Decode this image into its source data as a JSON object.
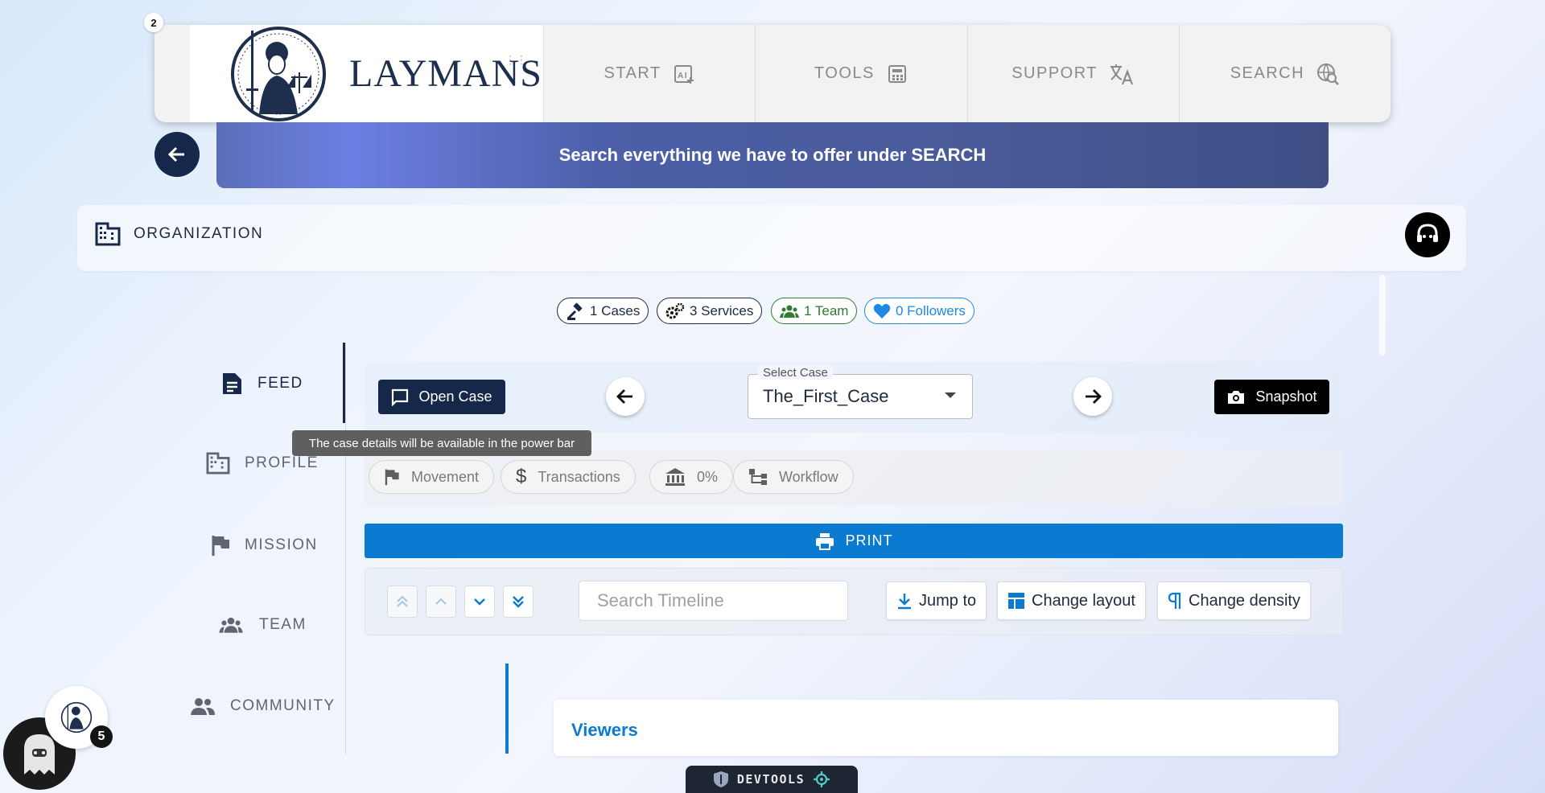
{
  "nav": {
    "badge": "2",
    "logo_text": "LAYMANS",
    "items": [
      {
        "label": "START",
        "icon": "ai-spark-icon"
      },
      {
        "label": "TOOLS",
        "icon": "calculator-icon"
      },
      {
        "label": "SUPPORT",
        "icon": "translate-icon"
      },
      {
        "label": "SEARCH",
        "icon": "search-globe-icon"
      }
    ]
  },
  "banner": {
    "text": "Search everything we have to offer under SEARCH"
  },
  "header": {
    "title": "ORGANIZATION"
  },
  "stats": {
    "cases": "1 Cases",
    "services": "3 Services",
    "team": "1 Team",
    "followers": "0 Followers"
  },
  "sidebar": {
    "items": [
      {
        "label": "FEED",
        "active": true
      },
      {
        "label": "PROFILE"
      },
      {
        "label": "MISSION"
      },
      {
        "label": "TEAM"
      },
      {
        "label": "COMMUNITY"
      }
    ]
  },
  "case_bar": {
    "open_case_label": "Open Case",
    "select_label": "Select Case",
    "selected_case": "The_First_Case",
    "snapshot_label": "Snapshot",
    "tooltip": "The case details will be available in the power bar"
  },
  "tabs": [
    {
      "label": "Movement"
    },
    {
      "label": "Transactions"
    },
    {
      "label": "0%"
    },
    {
      "label": "Workflow"
    }
  ],
  "print_label": "PRINT",
  "timeline": {
    "search_placeholder": "Search Timeline",
    "jump_label": "Jump to",
    "layout_label": "Change layout",
    "density_label": "Change density",
    "section_title": "Viewers"
  },
  "user": {
    "notification_count": "5"
  },
  "devtools": {
    "label": "DEVTOOLS"
  },
  "colors": {
    "navy": "#15284a",
    "accent_blue": "#0a7bd0",
    "team_green": "#2e7d32",
    "followers_blue": "#1e88e5"
  }
}
